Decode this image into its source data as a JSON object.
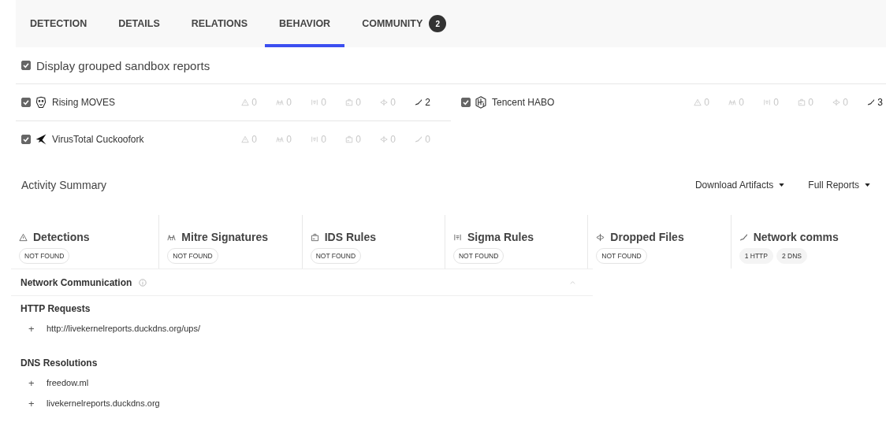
{
  "tabs": [
    {
      "label": "DETECTION",
      "selected": false
    },
    {
      "label": "DETAILS",
      "selected": false
    },
    {
      "label": "RELATIONS",
      "selected": false
    },
    {
      "label": "BEHAVIOR",
      "selected": true
    },
    {
      "label": "COMMUNITY",
      "selected": false,
      "badge": "2"
    }
  ],
  "grouped": {
    "label": "Display grouped sandbox reports",
    "checked": true
  },
  "sandboxes": [
    {
      "name": "Rising MOVES",
      "kind": "lion",
      "checked": true,
      "stats": [
        {
          "kind": "detections",
          "count": "0",
          "active": false
        },
        {
          "kind": "mitre",
          "count": "0",
          "active": false
        },
        {
          "kind": "sigma",
          "count": "0",
          "active": false
        },
        {
          "kind": "ids",
          "count": "0",
          "active": false
        },
        {
          "kind": "dropped",
          "count": "0",
          "active": false
        },
        {
          "kind": "network",
          "count": "2",
          "active": true
        }
      ]
    },
    {
      "name": "Tencent HABO",
      "kind": "habo",
      "checked": true,
      "stats": [
        {
          "kind": "detections",
          "count": "0",
          "active": false
        },
        {
          "kind": "mitre",
          "count": "0",
          "active": false
        },
        {
          "kind": "sigma",
          "count": "0",
          "active": false
        },
        {
          "kind": "ids",
          "count": "0",
          "active": false
        },
        {
          "kind": "dropped",
          "count": "0",
          "active": false
        },
        {
          "kind": "network",
          "count": "3",
          "active": true
        }
      ]
    },
    {
      "name": "VirusTotal Cuckoofork",
      "kind": "bird",
      "checked": true,
      "stats": [
        {
          "kind": "detections",
          "count": "0",
          "active": false
        },
        {
          "kind": "mitre",
          "count": "0",
          "active": false
        },
        {
          "kind": "sigma",
          "count": "0",
          "active": false
        },
        {
          "kind": "ids",
          "count": "0",
          "active": false
        },
        {
          "kind": "dropped",
          "count": "0",
          "active": false
        },
        {
          "kind": "network",
          "count": "0",
          "active": false
        }
      ]
    }
  ],
  "activity": {
    "title": "Activity Summary",
    "menus": [
      "Download Artifacts",
      "Full Reports"
    ]
  },
  "summary": [
    {
      "kind": "detections",
      "title": "Detections",
      "tags": [
        "NOT FOUND"
      ],
      "found": false
    },
    {
      "kind": "mitre",
      "title": "Mitre Signatures",
      "tags": [
        "NOT FOUND"
      ],
      "found": false
    },
    {
      "kind": "ids",
      "title": "IDS Rules",
      "tags": [
        "NOT FOUND"
      ],
      "found": false
    },
    {
      "kind": "sigma",
      "title": "Sigma Rules",
      "tags": [
        "NOT FOUND"
      ],
      "found": false
    },
    {
      "kind": "dropped",
      "title": "Dropped Files",
      "tags": [
        "NOT FOUND"
      ],
      "found": false
    },
    {
      "kind": "network",
      "title": "Network comms",
      "tags": [
        "1 HTTP",
        "2 DNS"
      ],
      "found": true
    }
  ],
  "network": {
    "title": "Network Communication",
    "expanded": true,
    "sections": [
      {
        "title": "HTTP Requests",
        "items": [
          {
            "marker": "+",
            "text": "http://livekernelreports.duckdns.org/ups/"
          }
        ]
      },
      {
        "title": "DNS Resolutions",
        "items": [
          {
            "marker": "+",
            "text": "freedow.ml"
          },
          {
            "marker": "+",
            "text": "livekernelreports.duckdns.org"
          }
        ]
      }
    ]
  }
}
